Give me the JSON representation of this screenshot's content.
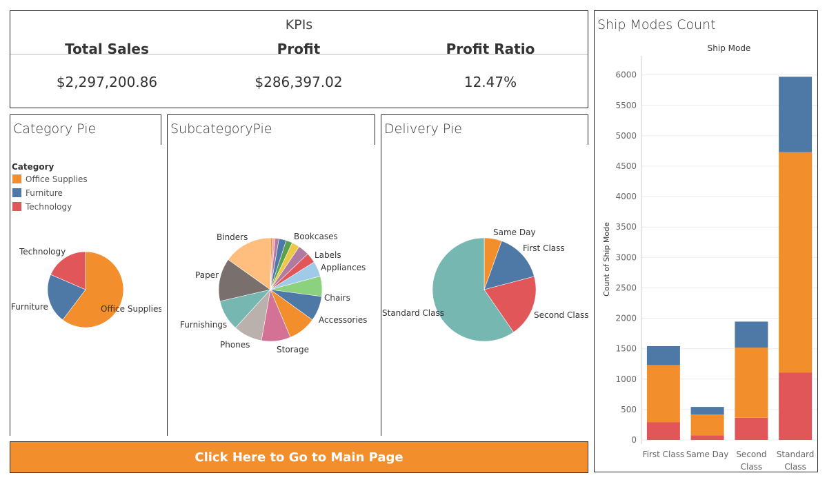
{
  "kpis": {
    "title": "KPIs",
    "total_sales_label": "Total Sales",
    "total_sales_value": "$2,297,200.86",
    "profit_label": "Profit",
    "profit_value": "$286,397.02",
    "profit_ratio_label": "Profit Ratio",
    "profit_ratio_value": "12.47%"
  },
  "category_pie": {
    "title": "Category Pie",
    "legend_title": "Category",
    "legend": [
      {
        "label": "Office Supplies",
        "color": "#f28e2b"
      },
      {
        "label": "Furniture",
        "color": "#4e79a7"
      },
      {
        "label": "Technology",
        "color": "#e15759"
      }
    ]
  },
  "subcategory_pie": {
    "title": "SubcategoryPie"
  },
  "delivery_pie": {
    "title": "Delivery Pie"
  },
  "ship_modes": {
    "title": "Ship Modes Count",
    "column_header": "Ship Mode",
    "y_axis_label": "Count of Ship Mode"
  },
  "button": {
    "label": "Click Here to Go to Main Page"
  },
  "chart_data": [
    {
      "type": "pie",
      "title": "Category Pie",
      "slices": [
        {
          "label": "Office Supplies",
          "value": 60.3,
          "color": "#f28e2b"
        },
        {
          "label": "Furniture",
          "value": 21.2,
          "color": "#4e79a7"
        },
        {
          "label": "Technology",
          "value": 18.5,
          "color": "#e15759"
        }
      ]
    },
    {
      "type": "pie",
      "title": "SubcategoryPie",
      "slices": [
        {
          "label": "",
          "value": 0.7,
          "color": "#f28e2b"
        },
        {
          "label": "",
          "value": 0.8,
          "color": "#ff9da7"
        },
        {
          "label": "",
          "value": 1.2,
          "color": "#b07aa1"
        },
        {
          "label": "Bookcases",
          "value": 2.3,
          "color": "#4e79a7"
        },
        {
          "label": "",
          "value": 2.0,
          "color": "#59a14f"
        },
        {
          "label": "",
          "value": 2.5,
          "color": "#edc948"
        },
        {
          "label": "Labels",
          "value": 3.5,
          "color": "#b07aa1"
        },
        {
          "label": "",
          "value": 3.2,
          "color": "#e15759"
        },
        {
          "label": "Appliances",
          "value": 4.8,
          "color": "#a0cbe8"
        },
        {
          "label": "Chairs",
          "value": 6.4,
          "color": "#8cd17d"
        },
        {
          "label": "Accessories",
          "value": 7.9,
          "color": "#4e79a7"
        },
        {
          "label": "Storage",
          "value": 8.8,
          "color": "#f28e2b"
        },
        {
          "label": "",
          "value": 9.2,
          "color": "#d37295"
        },
        {
          "label": "Phones",
          "value": 9.1,
          "color": "#bab0ac"
        },
        {
          "label": "Furnishings",
          "value": 9.7,
          "color": "#76b7b2"
        },
        {
          "label": "Paper",
          "value": 13.6,
          "color": "#79706e"
        },
        {
          "label": "Binders",
          "value": 15.3,
          "color": "#ffbe7d"
        }
      ]
    },
    {
      "type": "pie",
      "title": "Delivery Pie",
      "slices": [
        {
          "label": "Same Day",
          "value": 5.5,
          "color": "#f28e2b"
        },
        {
          "label": "First Class",
          "value": 15.4,
          "color": "#4e79a7"
        },
        {
          "label": "Second Class",
          "value": 19.5,
          "color": "#e15759"
        },
        {
          "label": "Standard Class",
          "value": 59.6,
          "color": "#76b7b2"
        }
      ]
    },
    {
      "type": "bar",
      "stacked": true,
      "title": "Ship Modes Count",
      "xlabel": "Ship Mode",
      "ylabel": "Count of Ship Mode",
      "categories": [
        "First Class",
        "Same Day",
        "Second Class",
        "Standard Class"
      ],
      "series": [
        {
          "color": "#e15759",
          "values": [
            293,
            75,
            364,
            1105
          ]
        },
        {
          "color": "#f28e2b",
          "values": [
            937,
            343,
            1152,
            3625
          ]
        },
        {
          "color": "#4e79a7",
          "values": [
            311,
            125,
            429,
            1240
          ]
        }
      ],
      "ylim": [
        0,
        6200
      ],
      "yticks": [
        0,
        500,
        1000,
        1500,
        2000,
        2500,
        3000,
        3500,
        4000,
        4500,
        5000,
        5500,
        6000
      ],
      "grid": true
    }
  ]
}
